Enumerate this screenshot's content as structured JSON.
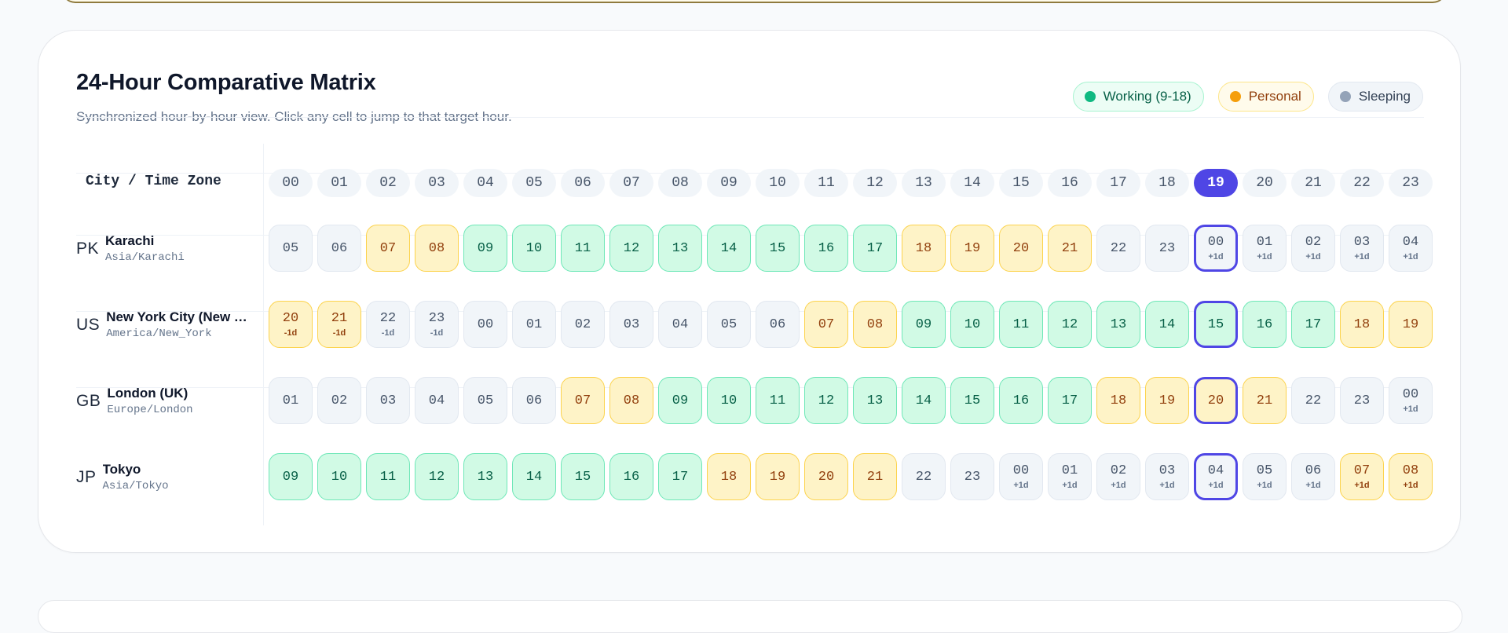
{
  "matrix": {
    "title": "24-Hour Comparative Matrix",
    "subtitle": "Synchronized hour-by-hour view. Click any cell to jump to that target hour.",
    "header_label": "City / Time Zone",
    "legend": [
      {
        "key": "working",
        "label": "Working (9-18)",
        "color": "#10b981"
      },
      {
        "key": "personal",
        "label": "Personal",
        "color": "#f59e0b"
      },
      {
        "key": "sleeping",
        "label": "Sleeping",
        "color": "#94a3b8"
      }
    ],
    "target_hour": "19",
    "hours": [
      "00",
      "01",
      "02",
      "03",
      "04",
      "05",
      "06",
      "07",
      "08",
      "09",
      "10",
      "11",
      "12",
      "13",
      "14",
      "15",
      "16",
      "17",
      "18",
      "19",
      "20",
      "21",
      "22",
      "23"
    ],
    "rows": [
      {
        "code": "PK",
        "name": "Karachi",
        "tz": "Asia/Karachi",
        "cells": [
          {
            "h": "05",
            "s": "sleeping"
          },
          {
            "h": "06",
            "s": "sleeping"
          },
          {
            "h": "07",
            "s": "personal"
          },
          {
            "h": "08",
            "s": "personal"
          },
          {
            "h": "09",
            "s": "working"
          },
          {
            "h": "10",
            "s": "working"
          },
          {
            "h": "11",
            "s": "working"
          },
          {
            "h": "12",
            "s": "working"
          },
          {
            "h": "13",
            "s": "working"
          },
          {
            "h": "14",
            "s": "working"
          },
          {
            "h": "15",
            "s": "working"
          },
          {
            "h": "16",
            "s": "working"
          },
          {
            "h": "17",
            "s": "working"
          },
          {
            "h": "18",
            "s": "personal"
          },
          {
            "h": "19",
            "s": "personal"
          },
          {
            "h": "20",
            "s": "personal"
          },
          {
            "h": "21",
            "s": "personal"
          },
          {
            "h": "22",
            "s": "sleeping"
          },
          {
            "h": "23",
            "s": "sleeping"
          },
          {
            "h": "00",
            "s": "sleeping",
            "off": "+1d"
          },
          {
            "h": "01",
            "s": "sleeping",
            "off": "+1d"
          },
          {
            "h": "02",
            "s": "sleeping",
            "off": "+1d"
          },
          {
            "h": "03",
            "s": "sleeping",
            "off": "+1d"
          },
          {
            "h": "04",
            "s": "sleeping",
            "off": "+1d"
          }
        ]
      },
      {
        "code": "US",
        "name": "New York City (New York)",
        "tz": "America/New_York",
        "cells": [
          {
            "h": "20",
            "s": "personal",
            "off": "-1d"
          },
          {
            "h": "21",
            "s": "personal",
            "off": "-1d"
          },
          {
            "h": "22",
            "s": "sleeping",
            "off": "-1d"
          },
          {
            "h": "23",
            "s": "sleeping",
            "off": "-1d"
          },
          {
            "h": "00",
            "s": "sleeping"
          },
          {
            "h": "01",
            "s": "sleeping"
          },
          {
            "h": "02",
            "s": "sleeping"
          },
          {
            "h": "03",
            "s": "sleeping"
          },
          {
            "h": "04",
            "s": "sleeping"
          },
          {
            "h": "05",
            "s": "sleeping"
          },
          {
            "h": "06",
            "s": "sleeping"
          },
          {
            "h": "07",
            "s": "personal"
          },
          {
            "h": "08",
            "s": "personal"
          },
          {
            "h": "09",
            "s": "working"
          },
          {
            "h": "10",
            "s": "working"
          },
          {
            "h": "11",
            "s": "working"
          },
          {
            "h": "12",
            "s": "working"
          },
          {
            "h": "13",
            "s": "working"
          },
          {
            "h": "14",
            "s": "working"
          },
          {
            "h": "15",
            "s": "working"
          },
          {
            "h": "16",
            "s": "working"
          },
          {
            "h": "17",
            "s": "working"
          },
          {
            "h": "18",
            "s": "personal"
          },
          {
            "h": "19",
            "s": "personal"
          }
        ]
      },
      {
        "code": "GB",
        "name": "London (UK)",
        "tz": "Europe/London",
        "cells": [
          {
            "h": "01",
            "s": "sleeping"
          },
          {
            "h": "02",
            "s": "sleeping"
          },
          {
            "h": "03",
            "s": "sleeping"
          },
          {
            "h": "04",
            "s": "sleeping"
          },
          {
            "h": "05",
            "s": "sleeping"
          },
          {
            "h": "06",
            "s": "sleeping"
          },
          {
            "h": "07",
            "s": "personal"
          },
          {
            "h": "08",
            "s": "personal"
          },
          {
            "h": "09",
            "s": "working"
          },
          {
            "h": "10",
            "s": "working"
          },
          {
            "h": "11",
            "s": "working"
          },
          {
            "h": "12",
            "s": "working"
          },
          {
            "h": "13",
            "s": "working"
          },
          {
            "h": "14",
            "s": "working"
          },
          {
            "h": "15",
            "s": "working"
          },
          {
            "h": "16",
            "s": "working"
          },
          {
            "h": "17",
            "s": "working"
          },
          {
            "h": "18",
            "s": "personal"
          },
          {
            "h": "19",
            "s": "personal"
          },
          {
            "h": "20",
            "s": "personal"
          },
          {
            "h": "21",
            "s": "personal"
          },
          {
            "h": "22",
            "s": "sleeping"
          },
          {
            "h": "23",
            "s": "sleeping"
          },
          {
            "h": "00",
            "s": "sleeping",
            "off": "+1d"
          }
        ]
      },
      {
        "code": "JP",
        "name": "Tokyo",
        "tz": "Asia/Tokyo",
        "cells": [
          {
            "h": "09",
            "s": "working"
          },
          {
            "h": "10",
            "s": "working"
          },
          {
            "h": "11",
            "s": "working"
          },
          {
            "h": "12",
            "s": "working"
          },
          {
            "h": "13",
            "s": "working"
          },
          {
            "h": "14",
            "s": "working"
          },
          {
            "h": "15",
            "s": "working"
          },
          {
            "h": "16",
            "s": "working"
          },
          {
            "h": "17",
            "s": "working"
          },
          {
            "h": "18",
            "s": "personal"
          },
          {
            "h": "19",
            "s": "personal"
          },
          {
            "h": "20",
            "s": "personal"
          },
          {
            "h": "21",
            "s": "personal"
          },
          {
            "h": "22",
            "s": "sleeping"
          },
          {
            "h": "23",
            "s": "sleeping"
          },
          {
            "h": "00",
            "s": "sleeping",
            "off": "+1d"
          },
          {
            "h": "01",
            "s": "sleeping",
            "off": "+1d"
          },
          {
            "h": "02",
            "s": "sleeping",
            "off": "+1d"
          },
          {
            "h": "03",
            "s": "sleeping",
            "off": "+1d"
          },
          {
            "h": "04",
            "s": "sleeping",
            "off": "+1d"
          },
          {
            "h": "05",
            "s": "sleeping",
            "off": "+1d"
          },
          {
            "h": "06",
            "s": "sleeping",
            "off": "+1d"
          },
          {
            "h": "07",
            "s": "personal",
            "off": "+1d"
          },
          {
            "h": "08",
            "s": "personal",
            "off": "+1d"
          }
        ]
      }
    ]
  }
}
